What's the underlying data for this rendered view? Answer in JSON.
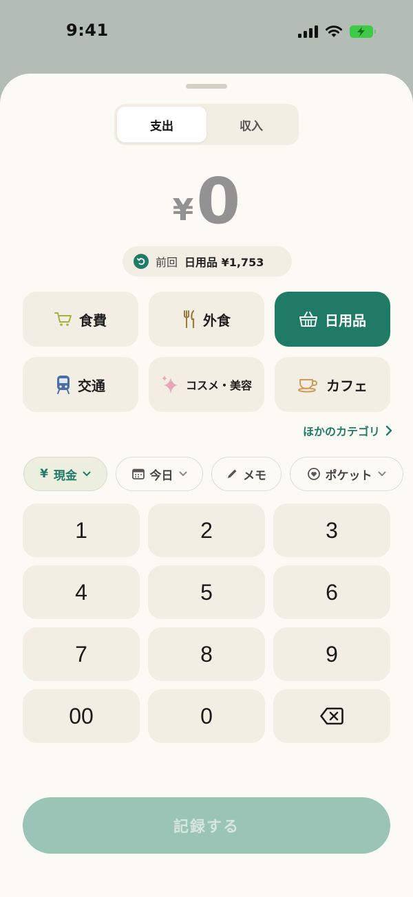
{
  "status": {
    "time": "9:41"
  },
  "segment": {
    "expense": "支出",
    "income": "収入"
  },
  "amount": {
    "currency": "¥",
    "value": "0"
  },
  "previous": {
    "label": "前回",
    "value": "日用品 ¥1,753"
  },
  "categories": [
    {
      "label": "食費",
      "icon": "cart-icon"
    },
    {
      "label": "外食",
      "icon": "fork-knife-icon"
    },
    {
      "label": "日用品",
      "icon": "basket-icon",
      "selected": true
    },
    {
      "label": "交通",
      "icon": "train-icon"
    },
    {
      "label": "コスメ・美容",
      "icon": "sparkle-icon"
    },
    {
      "label": "カフェ",
      "icon": "coffee-cup-icon"
    }
  ],
  "more_categories": "ほかのカテゴリ",
  "pills": {
    "payment": {
      "label": "現金",
      "symbol": "¥"
    },
    "date": {
      "label": "今日"
    },
    "memo": {
      "label": "メモ"
    },
    "pocket": {
      "label": "ポケット"
    }
  },
  "keypad": {
    "keys": [
      "1",
      "2",
      "3",
      "4",
      "5",
      "6",
      "7",
      "8",
      "9",
      "00",
      "0"
    ],
    "backspace_icon": "backspace-icon"
  },
  "submit_label": "記録する",
  "colors": {
    "accent": "#1f7a66",
    "submit_disabled": "#9ac4b5",
    "sheet_bg": "#fbfaf5",
    "tile_bg": "#f2eee3"
  }
}
